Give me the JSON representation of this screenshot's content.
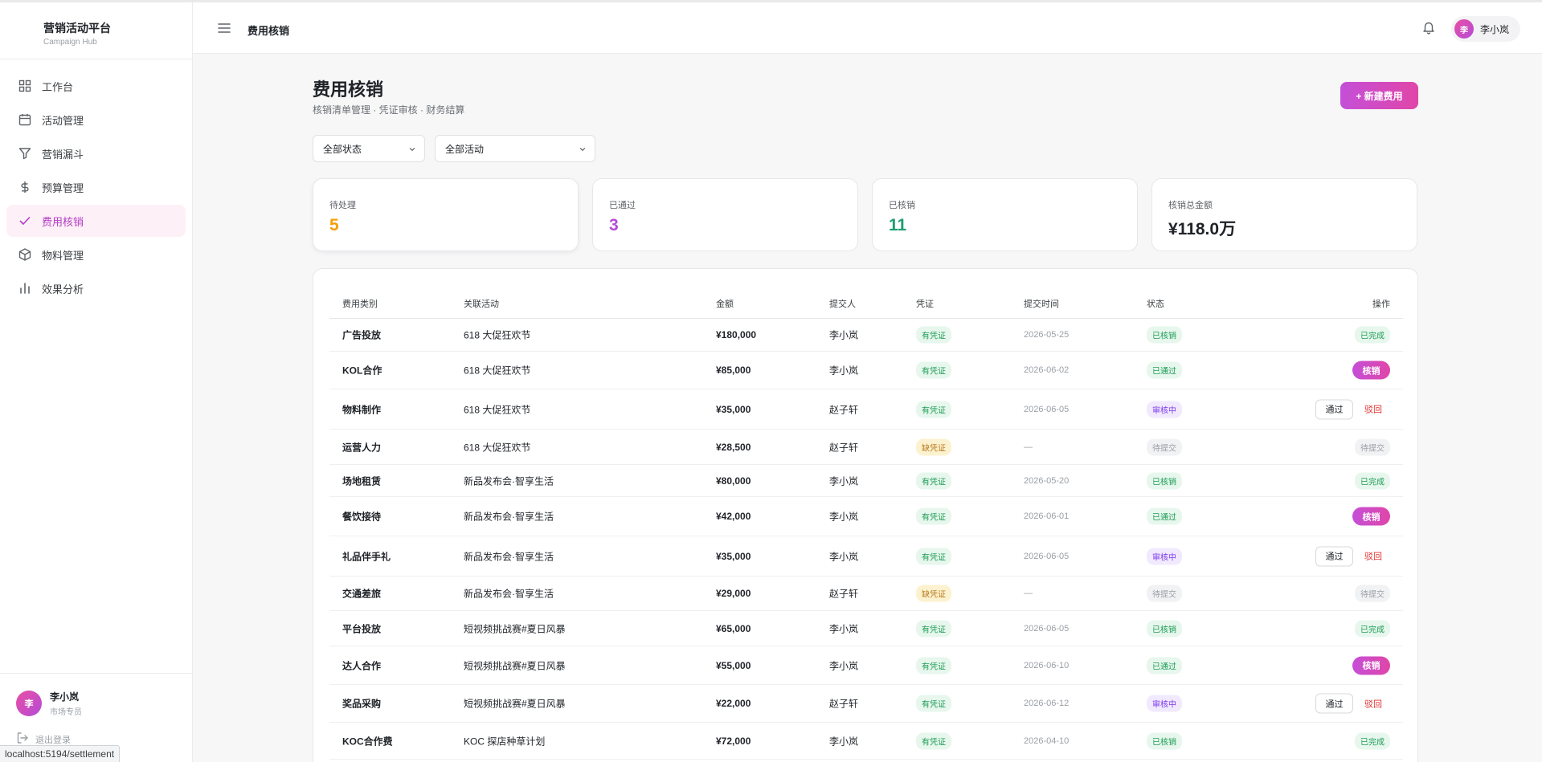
{
  "brand": {
    "title": "营销活动平台",
    "subtitle": "Campaign Hub"
  },
  "sidebar": {
    "items": [
      {
        "label": "工作台",
        "icon": "grid-icon"
      },
      {
        "label": "活动管理",
        "icon": "calendar-icon"
      },
      {
        "label": "营销漏斗",
        "icon": "funnel-icon"
      },
      {
        "label": "预算管理",
        "icon": "dollar-icon"
      },
      {
        "label": "费用核销",
        "icon": "check-icon",
        "active": true
      },
      {
        "label": "物料管理",
        "icon": "box-icon"
      },
      {
        "label": "效果分析",
        "icon": "bar-chart-icon"
      }
    ],
    "user": {
      "avatar": "李",
      "name": "李小岚",
      "role": "市场专员"
    },
    "logout": "退出登录"
  },
  "header": {
    "breadcrumb": "费用核销",
    "user": {
      "avatar": "李",
      "name": "李小岚"
    }
  },
  "page": {
    "title": "费用核销",
    "subtitle": "核销清单管理 · 凭证审核 · 财务结算",
    "new_button": "+ 新建费用"
  },
  "filters": {
    "status": "全部状态",
    "activity": "全部活动"
  },
  "stats": [
    {
      "label": "待处理",
      "value": "5",
      "color": "#f5a00a"
    },
    {
      "label": "已通过",
      "value": "3",
      "color": "#b44bd8"
    },
    {
      "label": "已核销",
      "value": "11",
      "color": "#1f9d72"
    },
    {
      "label": "核销总金额",
      "value": "¥118.0万",
      "color": "#1f2328"
    }
  ],
  "table": {
    "columns": [
      "费用类别",
      "关联活动",
      "金额",
      "提交人",
      "凭证",
      "提交时间",
      "状态",
      "操作"
    ],
    "rows": [
      {
        "category": "广告投放",
        "activity": "618 大促狂欢节",
        "amount": "¥180,000",
        "submitter": "李小岚",
        "voucher": "有凭证",
        "time": "2026-05-25",
        "status": "已核销",
        "action": "已完成"
      },
      {
        "category": "KOL合作",
        "activity": "618 大促狂欢节",
        "amount": "¥85,000",
        "submitter": "李小岚",
        "voucher": "有凭证",
        "time": "2026-06-02",
        "status": "已通过",
        "action": "核销"
      },
      {
        "category": "物料制作",
        "activity": "618 大促狂欢节",
        "amount": "¥35,000",
        "submitter": "赵子轩",
        "voucher": "有凭证",
        "time": "2026-06-05",
        "status": "审核中",
        "action": "review"
      },
      {
        "category": "运营人力",
        "activity": "618 大促狂欢节",
        "amount": "¥28,500",
        "submitter": "赵子轩",
        "voucher": "缺凭证",
        "time": "—",
        "status": "待提交",
        "action": "待提交"
      },
      {
        "category": "场地租赁",
        "activity": "新品发布会·智享生活",
        "amount": "¥80,000",
        "submitter": "李小岚",
        "voucher": "有凭证",
        "time": "2026-05-20",
        "status": "已核销",
        "action": "已完成"
      },
      {
        "category": "餐饮接待",
        "activity": "新品发布会·智享生活",
        "amount": "¥42,000",
        "submitter": "李小岚",
        "voucher": "有凭证",
        "time": "2026-06-01",
        "status": "已通过",
        "action": "核销"
      },
      {
        "category": "礼品伴手礼",
        "activity": "新品发布会·智享生活",
        "amount": "¥35,000",
        "submitter": "李小岚",
        "voucher": "有凭证",
        "time": "2026-06-05",
        "status": "审核中",
        "action": "review"
      },
      {
        "category": "交通差旅",
        "activity": "新品发布会·智享生活",
        "amount": "¥29,000",
        "submitter": "赵子轩",
        "voucher": "缺凭证",
        "time": "—",
        "status": "待提交",
        "action": "待提交"
      },
      {
        "category": "平台投放",
        "activity": "短视频挑战赛#夏日风暴",
        "amount": "¥65,000",
        "submitter": "李小岚",
        "voucher": "有凭证",
        "time": "2026-06-05",
        "status": "已核销",
        "action": "已完成"
      },
      {
        "category": "达人合作",
        "activity": "短视频挑战赛#夏日风暴",
        "amount": "¥55,000",
        "submitter": "李小岚",
        "voucher": "有凭证",
        "time": "2026-06-10",
        "status": "已通过",
        "action": "核销"
      },
      {
        "category": "奖品采购",
        "activity": "短视频挑战赛#夏日风暴",
        "amount": "¥22,000",
        "submitter": "赵子轩",
        "voucher": "有凭证",
        "time": "2026-06-12",
        "status": "审核中",
        "action": "review"
      },
      {
        "category": "KOC合作费",
        "activity": "KOC 探店种草计划",
        "amount": "¥72,000",
        "submitter": "李小岚",
        "voucher": "有凭证",
        "time": "2026-04-10",
        "status": "已核销",
        "action": "已完成"
      }
    ],
    "action_labels": {
      "pass": "通过",
      "reject": "驳回"
    }
  },
  "status_bar_url": "localhost:5194/settlement"
}
